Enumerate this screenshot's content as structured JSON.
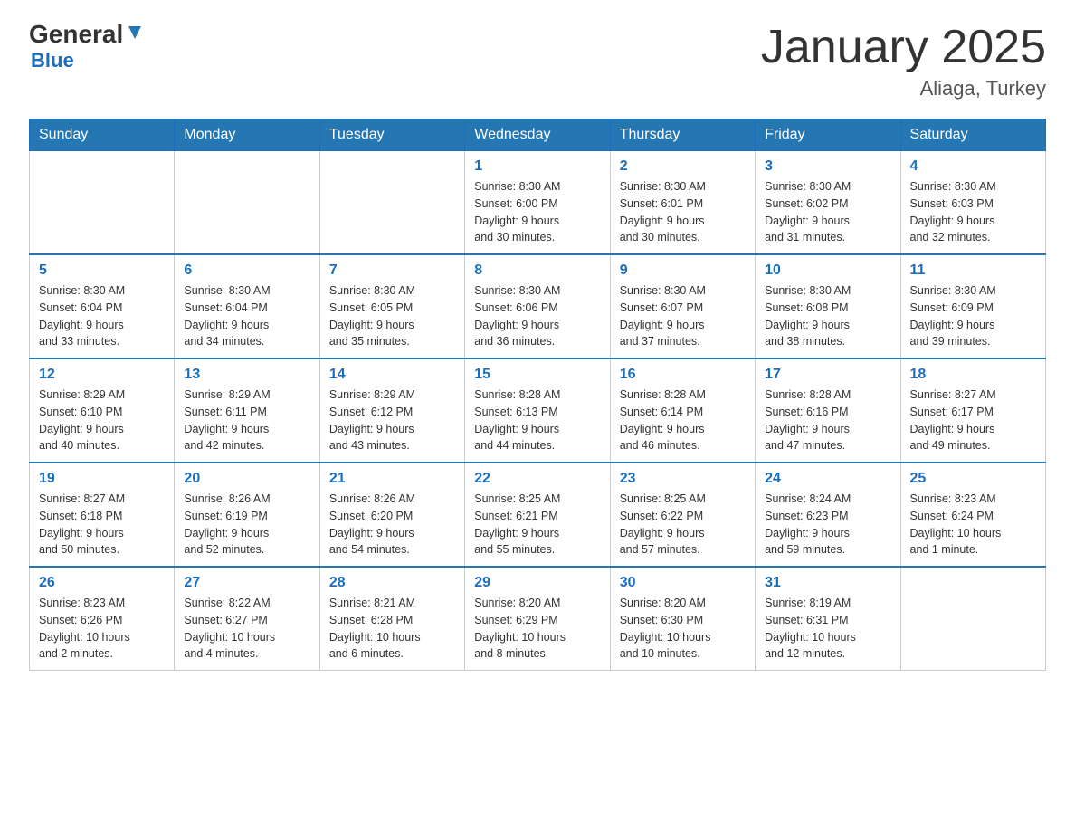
{
  "logo": {
    "general": "General",
    "blue": "Blue"
  },
  "title": "January 2025",
  "subtitle": "Aliaga, Turkey",
  "days_of_week": [
    "Sunday",
    "Monday",
    "Tuesday",
    "Wednesday",
    "Thursday",
    "Friday",
    "Saturday"
  ],
  "weeks": [
    [
      {
        "day": "",
        "info": ""
      },
      {
        "day": "",
        "info": ""
      },
      {
        "day": "",
        "info": ""
      },
      {
        "day": "1",
        "info": "Sunrise: 8:30 AM\nSunset: 6:00 PM\nDaylight: 9 hours\nand 30 minutes."
      },
      {
        "day": "2",
        "info": "Sunrise: 8:30 AM\nSunset: 6:01 PM\nDaylight: 9 hours\nand 30 minutes."
      },
      {
        "day": "3",
        "info": "Sunrise: 8:30 AM\nSunset: 6:02 PM\nDaylight: 9 hours\nand 31 minutes."
      },
      {
        "day": "4",
        "info": "Sunrise: 8:30 AM\nSunset: 6:03 PM\nDaylight: 9 hours\nand 32 minutes."
      }
    ],
    [
      {
        "day": "5",
        "info": "Sunrise: 8:30 AM\nSunset: 6:04 PM\nDaylight: 9 hours\nand 33 minutes."
      },
      {
        "day": "6",
        "info": "Sunrise: 8:30 AM\nSunset: 6:04 PM\nDaylight: 9 hours\nand 34 minutes."
      },
      {
        "day": "7",
        "info": "Sunrise: 8:30 AM\nSunset: 6:05 PM\nDaylight: 9 hours\nand 35 minutes."
      },
      {
        "day": "8",
        "info": "Sunrise: 8:30 AM\nSunset: 6:06 PM\nDaylight: 9 hours\nand 36 minutes."
      },
      {
        "day": "9",
        "info": "Sunrise: 8:30 AM\nSunset: 6:07 PM\nDaylight: 9 hours\nand 37 minutes."
      },
      {
        "day": "10",
        "info": "Sunrise: 8:30 AM\nSunset: 6:08 PM\nDaylight: 9 hours\nand 38 minutes."
      },
      {
        "day": "11",
        "info": "Sunrise: 8:30 AM\nSunset: 6:09 PM\nDaylight: 9 hours\nand 39 minutes."
      }
    ],
    [
      {
        "day": "12",
        "info": "Sunrise: 8:29 AM\nSunset: 6:10 PM\nDaylight: 9 hours\nand 40 minutes."
      },
      {
        "day": "13",
        "info": "Sunrise: 8:29 AM\nSunset: 6:11 PM\nDaylight: 9 hours\nand 42 minutes."
      },
      {
        "day": "14",
        "info": "Sunrise: 8:29 AM\nSunset: 6:12 PM\nDaylight: 9 hours\nand 43 minutes."
      },
      {
        "day": "15",
        "info": "Sunrise: 8:28 AM\nSunset: 6:13 PM\nDaylight: 9 hours\nand 44 minutes."
      },
      {
        "day": "16",
        "info": "Sunrise: 8:28 AM\nSunset: 6:14 PM\nDaylight: 9 hours\nand 46 minutes."
      },
      {
        "day": "17",
        "info": "Sunrise: 8:28 AM\nSunset: 6:16 PM\nDaylight: 9 hours\nand 47 minutes."
      },
      {
        "day": "18",
        "info": "Sunrise: 8:27 AM\nSunset: 6:17 PM\nDaylight: 9 hours\nand 49 minutes."
      }
    ],
    [
      {
        "day": "19",
        "info": "Sunrise: 8:27 AM\nSunset: 6:18 PM\nDaylight: 9 hours\nand 50 minutes."
      },
      {
        "day": "20",
        "info": "Sunrise: 8:26 AM\nSunset: 6:19 PM\nDaylight: 9 hours\nand 52 minutes."
      },
      {
        "day": "21",
        "info": "Sunrise: 8:26 AM\nSunset: 6:20 PM\nDaylight: 9 hours\nand 54 minutes."
      },
      {
        "day": "22",
        "info": "Sunrise: 8:25 AM\nSunset: 6:21 PM\nDaylight: 9 hours\nand 55 minutes."
      },
      {
        "day": "23",
        "info": "Sunrise: 8:25 AM\nSunset: 6:22 PM\nDaylight: 9 hours\nand 57 minutes."
      },
      {
        "day": "24",
        "info": "Sunrise: 8:24 AM\nSunset: 6:23 PM\nDaylight: 9 hours\nand 59 minutes."
      },
      {
        "day": "25",
        "info": "Sunrise: 8:23 AM\nSunset: 6:24 PM\nDaylight: 10 hours\nand 1 minute."
      }
    ],
    [
      {
        "day": "26",
        "info": "Sunrise: 8:23 AM\nSunset: 6:26 PM\nDaylight: 10 hours\nand 2 minutes."
      },
      {
        "day": "27",
        "info": "Sunrise: 8:22 AM\nSunset: 6:27 PM\nDaylight: 10 hours\nand 4 minutes."
      },
      {
        "day": "28",
        "info": "Sunrise: 8:21 AM\nSunset: 6:28 PM\nDaylight: 10 hours\nand 6 minutes."
      },
      {
        "day": "29",
        "info": "Sunrise: 8:20 AM\nSunset: 6:29 PM\nDaylight: 10 hours\nand 8 minutes."
      },
      {
        "day": "30",
        "info": "Sunrise: 8:20 AM\nSunset: 6:30 PM\nDaylight: 10 hours\nand 10 minutes."
      },
      {
        "day": "31",
        "info": "Sunrise: 8:19 AM\nSunset: 6:31 PM\nDaylight: 10 hours\nand 12 minutes."
      },
      {
        "day": "",
        "info": ""
      }
    ]
  ]
}
